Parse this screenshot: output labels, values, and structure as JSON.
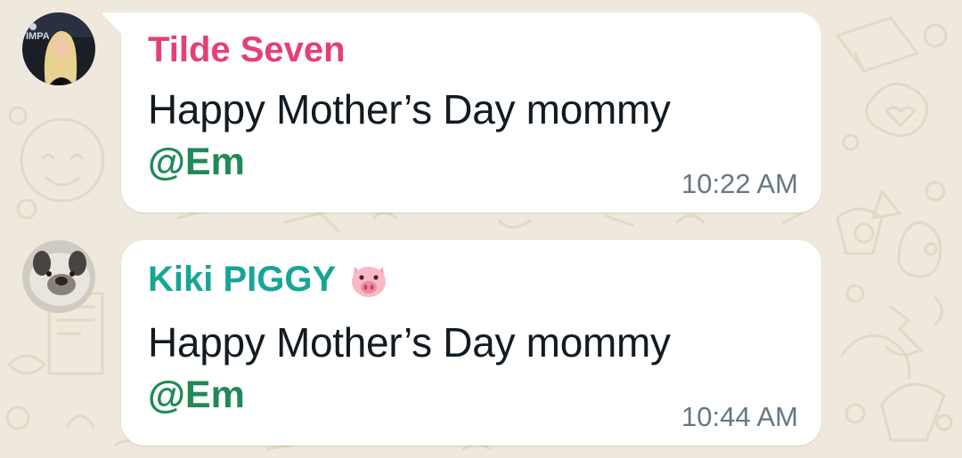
{
  "background": {
    "color": "#efe8dc",
    "doodle_color": "#e2d8c6"
  },
  "messages": [
    {
      "sender": "Tilde Seven",
      "sender_color": "#e53f7a",
      "text": "Happy Mother’s Day mommy",
      "mention": "@Em",
      "time": "10:22 AM",
      "avatar": "photo-avatar-woman"
    },
    {
      "sender": "Kiki PIGGY",
      "sender_color": "#16a596",
      "sender_emoji_icon": "pig-face-icon",
      "text": "Happy Mother’s Day mommy",
      "mention": "@Em",
      "time": "10:44 AM",
      "avatar": "photo-avatar-dog"
    }
  ],
  "colors": {
    "bubble": "#ffffff",
    "mention": "#1f8a56",
    "timestamp": "#667781",
    "text": "#111b21"
  }
}
